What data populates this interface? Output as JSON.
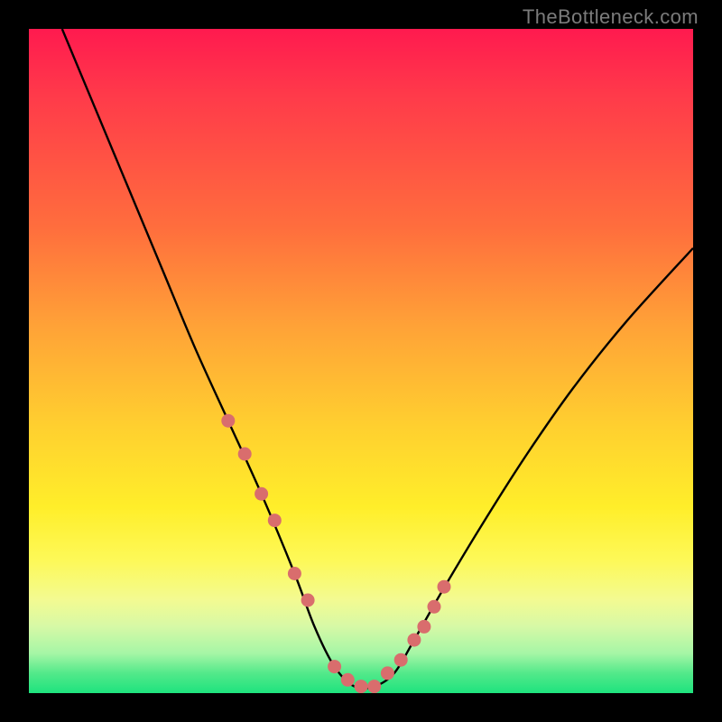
{
  "watermark": "TheBottleneck.com",
  "chart_data": {
    "type": "line",
    "title": "",
    "xlabel": "",
    "ylabel": "",
    "xlim": [
      0,
      100
    ],
    "ylim": [
      0,
      100
    ],
    "series": [
      {
        "name": "bottleneck-curve",
        "x": [
          5,
          10,
          15,
          20,
          25,
          30,
          35,
          40,
          43,
          46,
          49,
          52,
          55,
          58,
          62,
          68,
          75,
          82,
          90,
          100
        ],
        "y": [
          100,
          88,
          76,
          64,
          52,
          41,
          30,
          18,
          10,
          4,
          1,
          1,
          3,
          8,
          15,
          25,
          36,
          46,
          56,
          67
        ]
      }
    ],
    "markers": {
      "name": "highlight-dots",
      "color": "#d96d6d",
      "x": [
        30,
        32.5,
        35,
        37,
        40,
        42,
        46,
        48,
        50,
        52,
        54,
        56,
        58,
        59.5,
        61,
        62.5
      ],
      "y": [
        41,
        36,
        30,
        26,
        18,
        14,
        4,
        2,
        1,
        1,
        3,
        5,
        8,
        10,
        13,
        16
      ]
    }
  }
}
